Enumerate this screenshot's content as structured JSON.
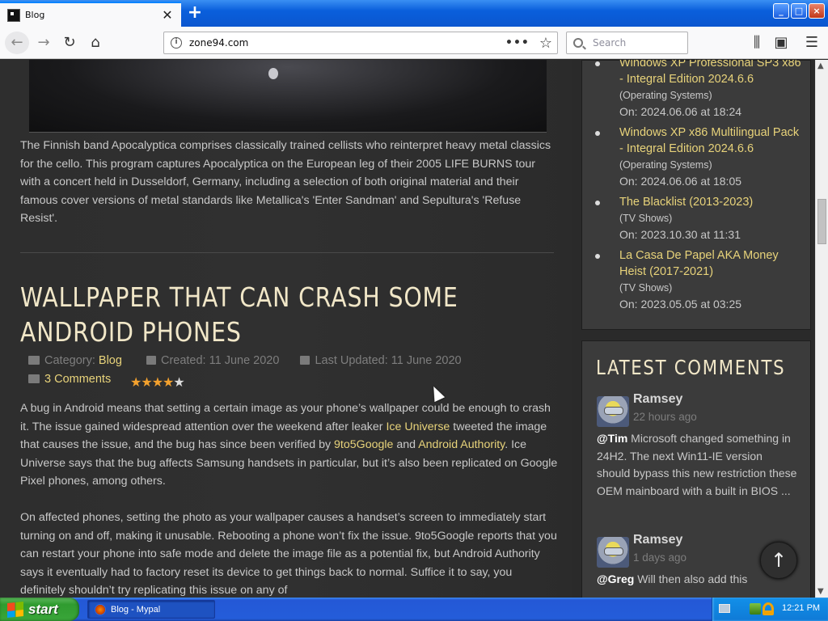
{
  "browser": {
    "tab_title": "Blog",
    "new_tab_glyph": "+",
    "url": "zone94.com",
    "search_placeholder": "Search",
    "window_buttons": {
      "minimize": "_",
      "maximize": "□",
      "close": "×"
    }
  },
  "article_prev": {
    "paragraph": "The Finnish band Apocalyptica comprises classically trained cellists who reinterpret heavy metal classics for the cello. This program captures Apocalyptica on the European leg of their 2005 LIFE BURNS tour with a concert held in Dusseldorf, Germany, including a selection of both original material and their famous cover versions of metal standards like Metallica's 'Enter Sandman' and Sepultura's 'Refuse Resist'."
  },
  "article": {
    "title": "WALLPAPER THAT CAN CRASH SOME ANDROID PHONES",
    "category_label": "Category:",
    "category_value": "Blog",
    "created": "Created: 11 June 2020",
    "updated": "Last Updated: 11 June 2020",
    "comments_link": "3 Comments",
    "rating_stars": 4,
    "rating_max": 5,
    "p1": {
      "t1": "A bug in Android means that setting a certain image as your phone’s wallpaper could be enough to crash it. The issue gained widespread attention over the weekend after leaker ",
      "link1": "Ice Universe",
      "t2": " tweeted the image that causes the issue, and the bug has since been verified by ",
      "link2": "9to5Google",
      "t3": " and ",
      "link3": "Android Authority",
      "t4": ". Ice Universe says that the bug affects Samsung handsets in particular, but it’s also been replicated on Google Pixel phones, among others."
    },
    "p2": "On affected phones, setting the photo as your wallpaper causes a handset’s screen to immediately start turning on and off, making it unusable. Rebooting a phone won’t fix the issue. 9to5Google reports that you can restart your phone into safe mode and delete the image file as a potential fix, but Android Authority says it eventually had to factory reset its device to get things back to normal. Suffice it to say, you definitely shouldn’t try replicating this issue on any of"
  },
  "sidebar": {
    "latest_items": [
      {
        "title": "Windows XP Professional SP3 x86 - Integral Edition 2024.6.6",
        "category": "(Operating Systems)",
        "date": "On: 2024.06.06 at 18:24"
      },
      {
        "title": "Windows XP x86 Multilingual Pack - Integral Edition 2024.6.6",
        "category": "(Operating Systems)",
        "date": "On: 2024.06.06 at 18:05"
      },
      {
        "title": "The Blacklist (2013-2023)",
        "category": "(TV Shows)",
        "date": "On: 2023.10.30 at 11:31"
      },
      {
        "title": "La Casa De Papel AKA Money Heist (2017-2021)",
        "category": "(TV Shows)",
        "date": "On: 2023.05.05 at 03:25"
      }
    ],
    "comments_heading": "LATEST COMMENTS",
    "comments": [
      {
        "author": "Ramsey",
        "ago": "22 hours ago",
        "mention": "@Tim",
        "text": " Microsoft changed something in 24H2. The next Win11-IE version should bypass this new restriction these OEM mainboard with a built in BIOS ..."
      },
      {
        "author": "Ramsey",
        "ago": "1 days ago",
        "mention": "@Greg",
        "text": " Will then also add this"
      }
    ],
    "back_to_top_glyph": "↑"
  },
  "taskbar": {
    "start_label": "start",
    "task_label": "Blog - Mypal",
    "clock": "12:21 PM"
  },
  "colors": {
    "accent_link": "#e8d37a",
    "title_cream": "#f1e7c8",
    "star": "#f3a12e"
  }
}
